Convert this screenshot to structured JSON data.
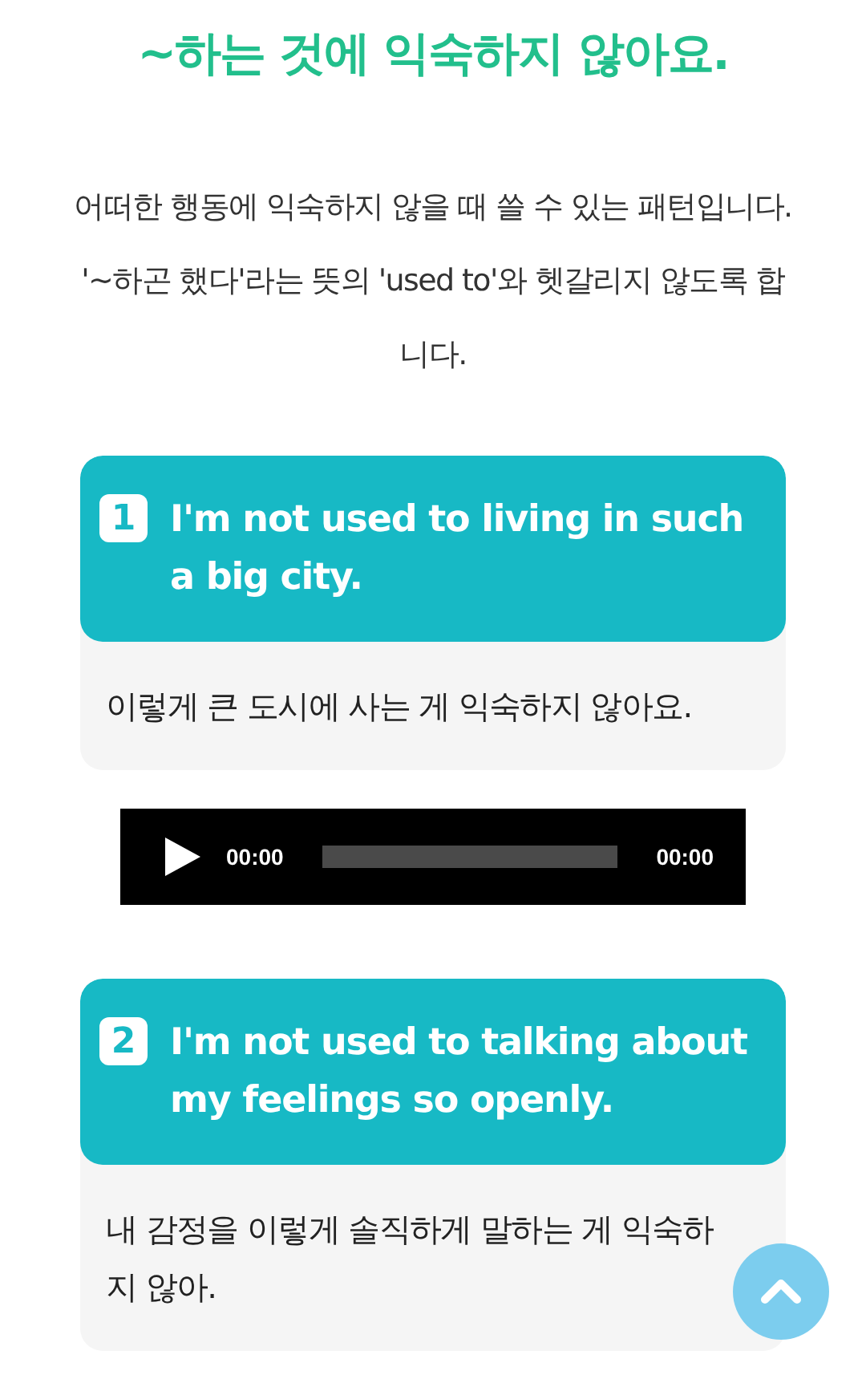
{
  "heading": "~하는 것에 익숙하지 않아요.",
  "intro": "어떠한 행동에 익숙하지 않을 때 쓸 수 있는 패턴입니다. '~하곤 했다'라는 뜻의 'used to'와 헷갈리지 않도록 합니다.",
  "examples": [
    {
      "number": "1",
      "english": "I'm not used to living in such a big city.",
      "korean": "이렇게 큰 도시에 사는 게 익숙하지 않아요.",
      "audio": {
        "current": "00:00",
        "duration": "00:00"
      }
    },
    {
      "number": "2",
      "english": "I'm not used to talking about my feelings so openly.",
      "korean": "내 감정을 이렇게 솔직하게 말하는 게 익숙하지 않아."
    }
  ]
}
